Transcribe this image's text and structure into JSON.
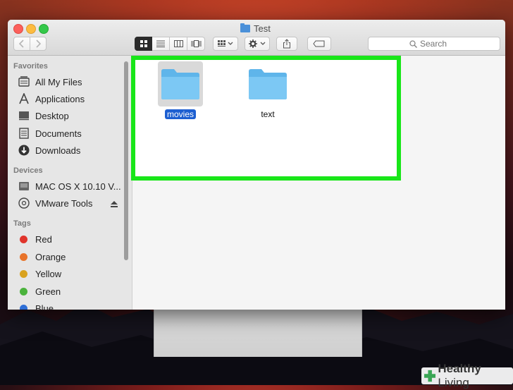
{
  "window": {
    "title": "Test"
  },
  "toolbar": {
    "back_icon": "chevron-left-icon",
    "forward_icon": "chevron-right-icon",
    "view_modes": [
      "icon-view-icon",
      "list-view-icon",
      "column-view-icon",
      "cover-flow-icon"
    ],
    "active_view": "icon-view-icon",
    "arrange_icon": "arrange-icon",
    "action_icon": "gear-icon",
    "share_icon": "share-icon",
    "tag_icon": "tag-icon",
    "search_placeholder": "Search"
  },
  "sidebar": {
    "favorites_heading": "Favorites",
    "favorites": [
      {
        "label": "All My Files",
        "icon": "all-my-files-icon"
      },
      {
        "label": "Applications",
        "icon": "applications-icon"
      },
      {
        "label": "Desktop",
        "icon": "desktop-icon"
      },
      {
        "label": "Documents",
        "icon": "documents-icon"
      },
      {
        "label": "Downloads",
        "icon": "downloads-icon"
      }
    ],
    "devices_heading": "Devices",
    "devices": [
      {
        "label": "MAC OS X 10.10 V...",
        "icon": "hard-drive-icon"
      },
      {
        "label": "VMware Tools",
        "icon": "disc-icon",
        "ejectable": true
      }
    ],
    "tags_heading": "Tags",
    "tags": [
      {
        "label": "Red",
        "color": "#e0342b"
      },
      {
        "label": "Orange",
        "color": "#e8732a"
      },
      {
        "label": "Yellow",
        "color": "#d9a21e"
      },
      {
        "label": "Green",
        "color": "#4bb33c"
      },
      {
        "label": "Blue",
        "color": "#2f6fd6"
      }
    ]
  },
  "content": {
    "items": [
      {
        "label": "movies",
        "icon": "folder-icon",
        "selected": true
      },
      {
        "label": "text",
        "icon": "folder-icon",
        "selected": false
      }
    ]
  },
  "colors": {
    "highlight_border": "#19e619",
    "selection": "#1d5fd1",
    "folder": "#6fc3f2"
  },
  "watermark": {
    "brand": "Healthy",
    "suffix": "Living"
  }
}
